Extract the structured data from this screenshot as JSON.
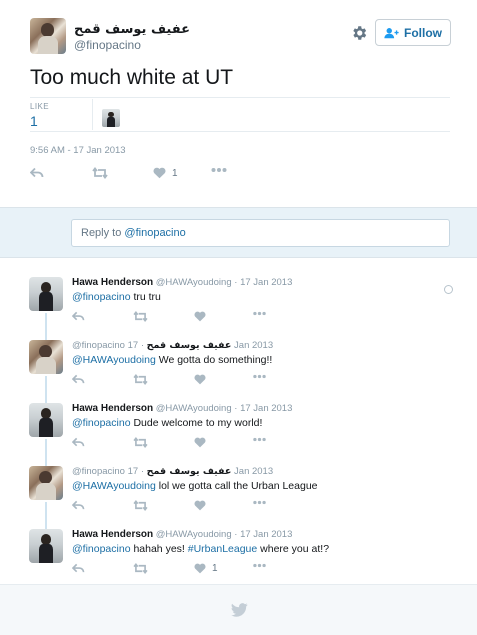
{
  "tweet": {
    "author_name": "عفيف يوسف قمح",
    "author_handle": "@finopacino",
    "text": "Too much white at UT",
    "follow_label": "Follow",
    "likes_label": "LIKE",
    "likes_count": "1",
    "timestamp": "9:56 AM - 17 Jan 2013",
    "actions": {
      "like_count": "1"
    }
  },
  "reply_box": {
    "prefix": "Reply to ",
    "mention": "@finopacino"
  },
  "replies": [
    {
      "name": "Hawa Henderson",
      "handle": "@HAWAyoudoing",
      "date": "17 Jan 2013",
      "mention": "@finopacino",
      "text": " tru tru",
      "like_count": ""
    },
    {
      "name": "عفيف يوسف قمح",
      "handle": "@finopacino",
      "date": "17 Jan 2013",
      "mention": "@HAWAyoudoing",
      "text": " We gotta do something!!",
      "like_count": ""
    },
    {
      "name": "Hawa Henderson",
      "handle": "@HAWAyoudoing",
      "date": "17 Jan 2013",
      "mention": "@finopacino",
      "text": " Dude welcome to my world!",
      "like_count": ""
    },
    {
      "name": "عفيف يوسف قمح",
      "handle": "@finopacino",
      "date": "17 Jan 2013",
      "mention": "@HAWAyoudoing",
      "text": " lol we gotta call the Urban League",
      "like_count": ""
    },
    {
      "name": "Hawa Henderson",
      "handle": "@HAWAyoudoing",
      "date": "17 Jan 2013",
      "mention": "@finopacino",
      "text_before": " hahah yes! ",
      "hashtag": "#UrbanLeague",
      "text_after": " where you at!?",
      "like_count": "1"
    }
  ],
  "date_separator": " · ",
  "icons": {
    "settings": "gear-icon",
    "follow": "add-user-icon",
    "reply": "reply-icon",
    "retweet": "retweet-icon",
    "like": "heart-icon",
    "more": "more-icon",
    "logo": "twitter-bird-icon"
  },
  "colors": {
    "accent": "#1d6fa5",
    "muted": "#8899a6",
    "reply_bg": "#e8f2f8"
  }
}
